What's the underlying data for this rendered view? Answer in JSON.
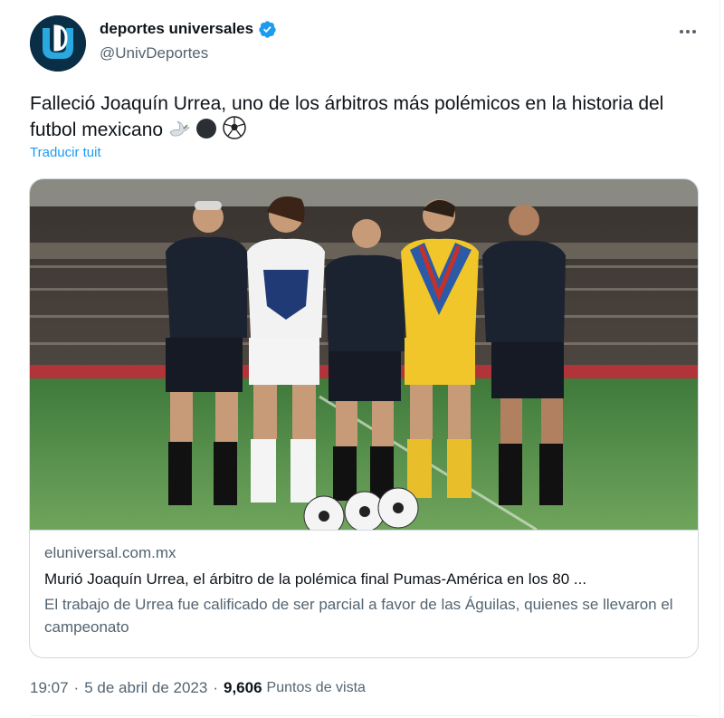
{
  "author": {
    "display_name": "deportes universales",
    "handle": "@UnivDeportes",
    "verified": true,
    "avatar_icon": "univ-deportes-logo",
    "avatar_letters": "UD"
  },
  "tweet": {
    "text": "Falleció Joaquín Urrea, uno de los árbitros más polémicos en la historia del futbol mexicano",
    "emojis": [
      "dove-icon",
      "black-circle-icon",
      "soccer-ball-icon"
    ],
    "translate_label": "Traducir tuit"
  },
  "card": {
    "image_icon": "referees-and-captains-photo",
    "domain": "eluniversal.com.mx",
    "title": "Murió Joaquín Urrea, el árbitro de la polémica final Pumas-América en los 80 ...",
    "description": "El trabajo de Urrea fue calificado de ser parcial a favor de las Águilas, quienes se llevaron el campeonato"
  },
  "meta": {
    "time": "19:07",
    "separator": "·",
    "date": "5 de abril de 2023",
    "views": "9,606",
    "views_label": "Puntos de vista"
  },
  "colors": {
    "accent": "#1d9bf0",
    "secondary_text": "#536471",
    "border": "#cfd9de"
  }
}
